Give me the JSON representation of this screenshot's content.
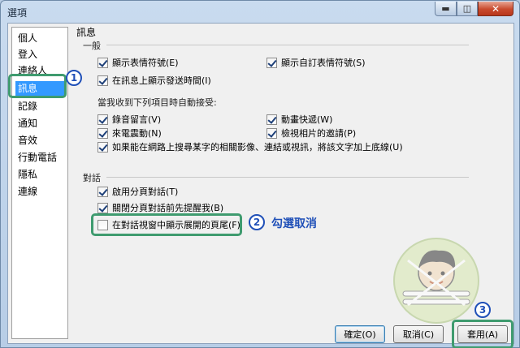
{
  "window": {
    "title": "選項",
    "min_glyph": "▬",
    "max_glyph": "◫",
    "close_glyph": "✕"
  },
  "sidebar": {
    "items": [
      {
        "label": "個人",
        "selected": false
      },
      {
        "label": "登入",
        "selected": false
      },
      {
        "label": "連絡人",
        "selected": false
      },
      {
        "label": "訊息",
        "selected": true
      },
      {
        "label": "記錄",
        "selected": false
      },
      {
        "label": "通知",
        "selected": false
      },
      {
        "label": "音效",
        "selected": false
      },
      {
        "label": "行動電話",
        "selected": false
      },
      {
        "label": "隱私",
        "selected": false
      },
      {
        "label": "連線",
        "selected": false
      }
    ]
  },
  "panel": {
    "title": "訊息",
    "general": {
      "heading": "一般",
      "options": [
        {
          "label": "顯示表情符號(E)",
          "checked": true
        },
        {
          "label": "顯示自訂表情符號(S)",
          "checked": true
        },
        {
          "label": "在訊息上顯示發送時間(I)",
          "checked": true
        }
      ],
      "auto_accept_heading": "當我收到下列項目時自動接受:",
      "auto_accept": [
        {
          "label": "錄音留言(V)",
          "checked": true
        },
        {
          "label": "動畫快遞(W)",
          "checked": true
        },
        {
          "label": "來電震動(N)",
          "checked": true
        },
        {
          "label": "檢視相片的邀請(P)",
          "checked": true
        },
        {
          "label": "如果能在網路上搜尋某字的相關影像、連結或視訊，將該文字加上底線(U)",
          "checked": true
        }
      ]
    },
    "conversation": {
      "heading": "對話",
      "options": [
        {
          "label": "啟用分頁對話(T)",
          "checked": true
        },
        {
          "label": "關閉分頁對話前先提醒我(B)",
          "checked": true
        },
        {
          "label": "在對話視窗中顯示展開的頁尾(F)",
          "checked": false
        }
      ]
    }
  },
  "annotations": {
    "step1": "1",
    "step2": "2",
    "step2_note": "勾選取消",
    "step3": "3"
  },
  "buttons": {
    "ok": "確定(O)",
    "cancel": "取消(C)",
    "apply": "套用(A)"
  },
  "colors": {
    "highlight": "#3f9b6f",
    "step_marker": "#2050b8",
    "selection": "#3399ff"
  }
}
